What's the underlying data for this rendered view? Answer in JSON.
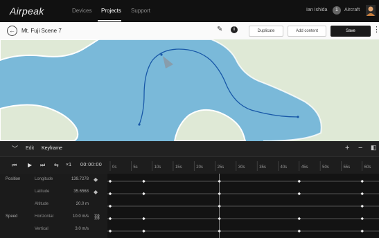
{
  "app": {
    "logo": "Airpeak",
    "nav": [
      {
        "label": "Devices",
        "active": false
      },
      {
        "label": "Projects",
        "active": true
      },
      {
        "label": "Support",
        "active": false
      }
    ],
    "account": {
      "name": "Ian Ishida",
      "badge": "1",
      "org": "Aircraft"
    }
  },
  "project": {
    "title": "Mt. Fuji Scene 7",
    "buttons": {
      "duplicate": "Duplicate",
      "add_content": "Add content",
      "save": "Save"
    }
  },
  "timeline": {
    "edit_label": "Edit",
    "mode_label": "Keyframe",
    "timecode": "00:00:00",
    "transport": [
      "⏮",
      "▶",
      "⏭",
      "⇆",
      "×1"
    ],
    "ticks": [
      "0s",
      "5s",
      "10s",
      "15s",
      "20s",
      "25s",
      "30s",
      "35s",
      "40s",
      "45s",
      "50s",
      "55s",
      "60s"
    ],
    "params": [
      {
        "group": "Position",
        "name": "Longitude",
        "value": "139.7278",
        "icon": "diamond-icon"
      },
      {
        "group": "",
        "name": "Latitude",
        "value": "35.6568",
        "icon": "diamond-icon"
      },
      {
        "group": "",
        "name": "Altitude",
        "value": "20.0 m",
        "icon": ""
      },
      {
        "group": "Speed",
        "name": "Horizontal",
        "value": "10.0 m/s",
        "icon": "link-icon"
      },
      {
        "group": "",
        "name": "Vertical",
        "value": "3.0 m/s",
        "icon": ""
      }
    ],
    "keyframe_tracks": [
      [
        0,
        8,
        26,
        45,
        60
      ],
      [
        0,
        8,
        26,
        45,
        60
      ],
      [
        0,
        26,
        60
      ],
      [
        0,
        8,
        26,
        45,
        60
      ],
      [
        0,
        8,
        26,
        45,
        60
      ]
    ],
    "playhead_s": 26,
    "duration_s": 64
  },
  "colors": {
    "water": "#7ab9d9",
    "land": "#dfe9d6",
    "path": "#1858a8",
    "accent": "#ffffff"
  }
}
